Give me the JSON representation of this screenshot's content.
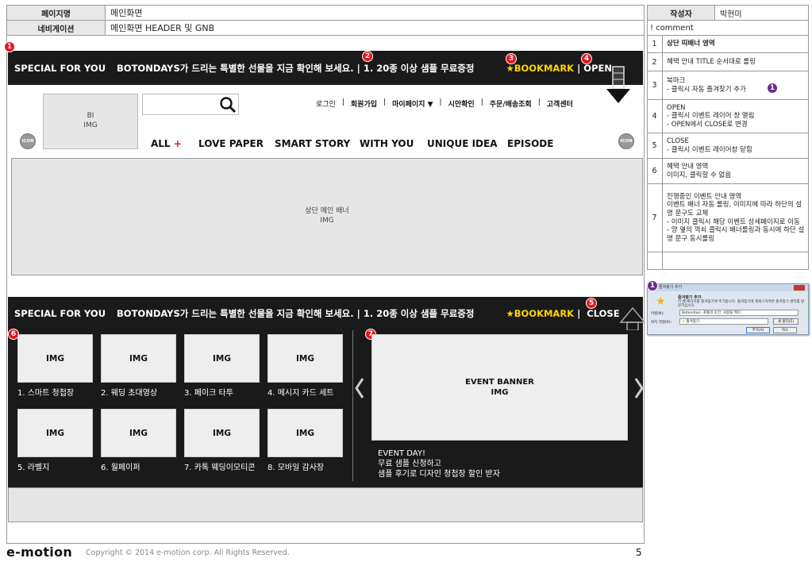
{
  "header": {
    "page_label": "페이지명",
    "page_value": "메인화면",
    "nav_label": "네비게이션",
    "nav_value": "메인화면 HEADER 및 GNB",
    "author_label": "작성자",
    "author_value": "박현미"
  },
  "comment": {
    "title": "! comment",
    "rows": [
      {
        "num": "1",
        "text": "상단 띠배너 영역"
      },
      {
        "num": "2",
        "text": "혜택 안내 TITLE 순서대로 롤링"
      },
      {
        "num": "3",
        "text": "북마크\n- 클릭시 자동 즐겨찾기 추가"
      },
      {
        "num": "4",
        "text": "OPEN\n- 클릭시 이벤트 레이어 창 열림\n- OPEN에서 CLOSE로 변경"
      },
      {
        "num": "5",
        "text": "CLOSE\n- 클릭시 이벤트 레이어창 닫힘"
      },
      {
        "num": "6",
        "text": "혜택 안내 영역\n이미지, 클릭할 수 없음"
      },
      {
        "num": "7",
        "text": "진행중인 이벤트 안내 영역\n이벤트 배너 자동 롤링, 이미지에 따라 하단의 설명 문구도 교체\n- 이미지 클릭시 해당 이벤트 상세페이지로 이동\n- 양 옆의 꺽쇠 클릭시 배너롤링과 동시에 하단 설명 문구 동시롤링"
      }
    ]
  },
  "topbar": {
    "special": "SPECIAL FOR YOU",
    "message": "BOTONDAYS가 드리는 특별한 선물을 지금 확인해 보세요. | 1. 20종 이상 샘플 무료증정",
    "bookmark": "★BOOKMARK",
    "sep": "|",
    "open": "OPEN",
    "close": "CLOSE"
  },
  "markers": {
    "m1": "1",
    "m2": "2",
    "m3": "3",
    "m4": "4",
    "m5": "5",
    "m6": "6",
    "m7": "7"
  },
  "site": {
    "bi_line1": "BI",
    "bi_line2": "IMG",
    "icon": "ICON",
    "util": [
      "로그인",
      "|",
      "회원가입",
      "|",
      "마이페이지 ▼",
      "|",
      "시안확인",
      "|",
      "주문/배송조회",
      "|",
      "고객센터"
    ],
    "gnb": [
      "ALL",
      "LOVE PAPER",
      "SMART STORY",
      "WITH YOU",
      "UNIQUE IDEA",
      "EPISODE"
    ],
    "gnb_plus": "+",
    "banner_line1": "상단 메인 배너",
    "banner_line2": "IMG"
  },
  "layer": {
    "img": "IMG",
    "thumbs": [
      "1. 스마트 청첩장",
      "2. 웨딩 초대영상",
      "3. 페이크 타투",
      "4. 메시지 카드 세트",
      "5. 라벨지",
      "6. 월페이퍼",
      "7. 카톡 웨딩이모티콘",
      "8. 모바일 감사장"
    ],
    "event_banner_line1": "EVENT BANNER",
    "event_banner_line2": "IMG",
    "event_desc": [
      "EVENT DAY!",
      "무료 샘플 신청하고",
      "샘플 후기로 디자인 청첩장 할인 받자"
    ],
    "prev": "‹",
    "next": "›"
  },
  "dialog": {
    "title": "즐겨찾기 추가",
    "heading": "즐겨찾기 추가",
    "desc": "이 웹 페이지를 즐겨찾기에 추가합니다. 즐겨찾기에 액세스하려면 즐겨찾기 센터를 방문하십시오.",
    "name_label": "이름(N):",
    "name_value": "Botondays -포통의 순간, 사랑을 찍다",
    "folder_label": "위치 지정(R):",
    "folder_value": "즐겨찾기",
    "new_folder": "새 폴더(E)",
    "add": "추가(A)",
    "cancel": "취소",
    "marker": "1"
  },
  "footer": {
    "logo": "e-motion",
    "copyright": "Copyright © 2014 e-motion corp. All Rights Reserved.",
    "page": "5"
  }
}
